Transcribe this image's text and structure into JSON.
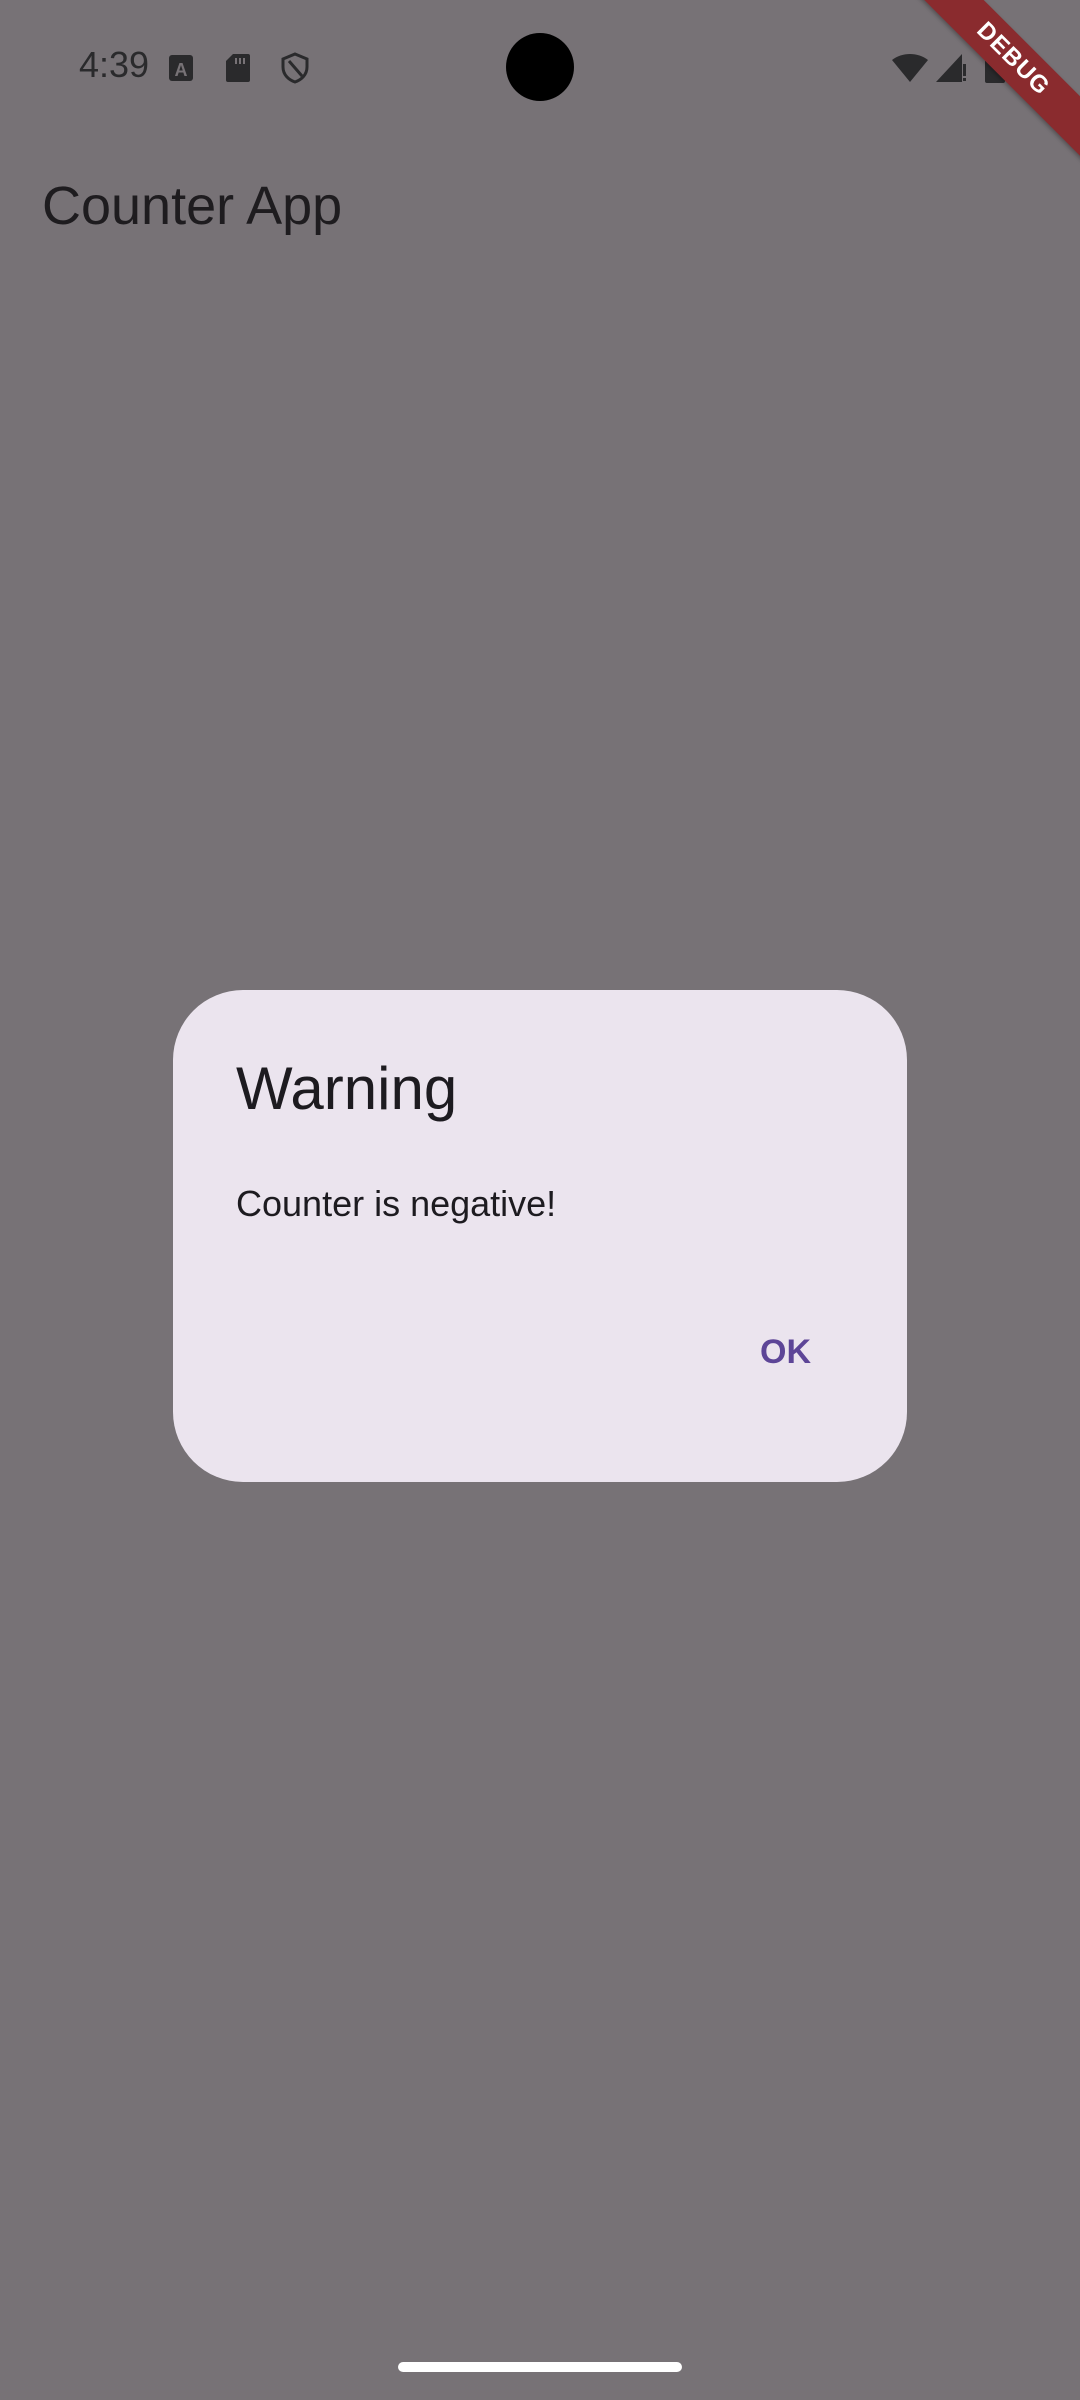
{
  "status_bar": {
    "time": "4:39",
    "icons_left": [
      "font-a-icon",
      "sd-card-icon",
      "shield-icon"
    ],
    "icons_right": [
      "wifi-icon",
      "signal-icon",
      "battery-icon"
    ]
  },
  "debug_banner": "DEBUG",
  "app_bar": {
    "title": "Counter App"
  },
  "dialog": {
    "title": "Warning",
    "message": "Counter is negative!",
    "ok_label": "OK",
    "accent_color": "#5d4597"
  },
  "colors": {
    "scrim": "#777276",
    "dialog_bg": "#ebe4ee",
    "debug_ribbon": "#8a2b2e"
  }
}
